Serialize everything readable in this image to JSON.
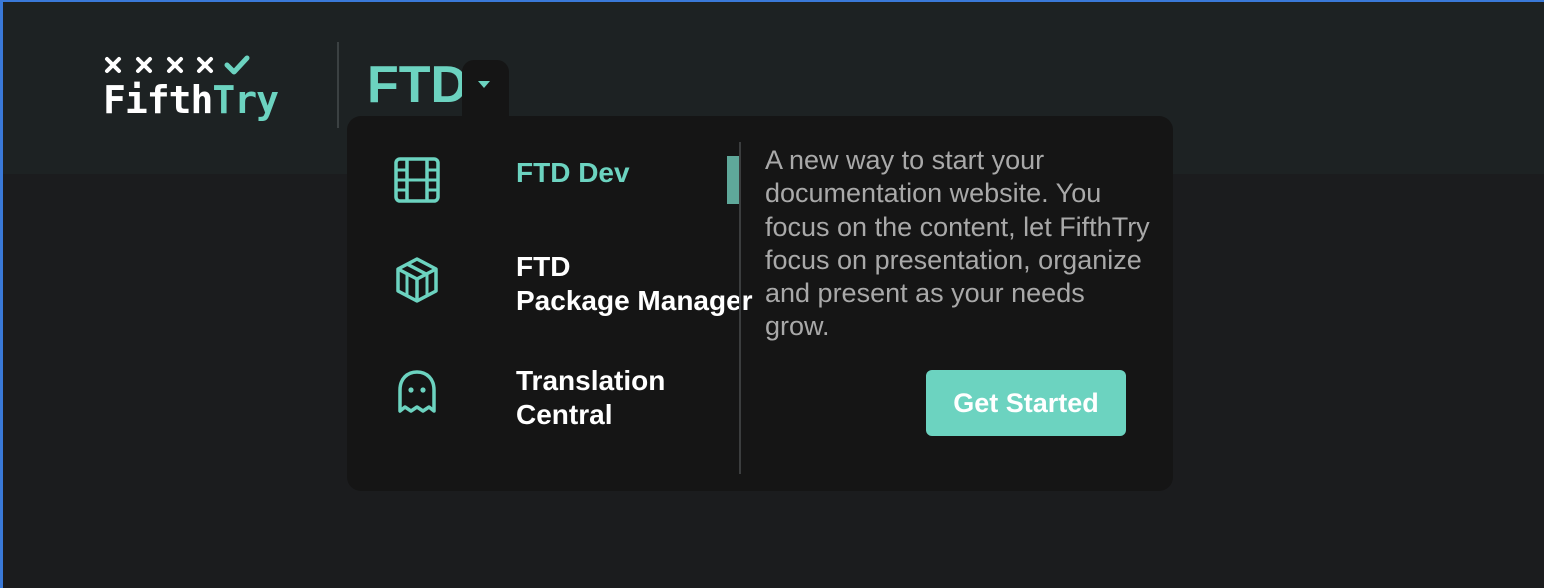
{
  "brand": {
    "logo_left": "Fifth",
    "logo_right": "Try",
    "product": "FTD"
  },
  "colors": {
    "accent": "#6cd3c0",
    "header_bg": "#1d2223",
    "page_bg": "#1b1c1e",
    "panel_bg": "#151515",
    "text_primary": "#ffffff",
    "text_muted": "#a9a9a9"
  },
  "dropdown": {
    "items": [
      {
        "label": "FTD Dev",
        "icon": "film-strip-icon",
        "active": true
      },
      {
        "label_line1": "FTD",
        "label_line2": "Package Manager",
        "icon": "cube-icon",
        "active": false
      },
      {
        "label_line1": "Translation",
        "label_line2": "Central",
        "icon": "ghost-icon",
        "active": false
      }
    ],
    "description": "A new way to start your documentation website. You focus on the content, let FifthTry focus on presentation, organize and present as your needs grow.",
    "cta_label": "Get Started"
  }
}
